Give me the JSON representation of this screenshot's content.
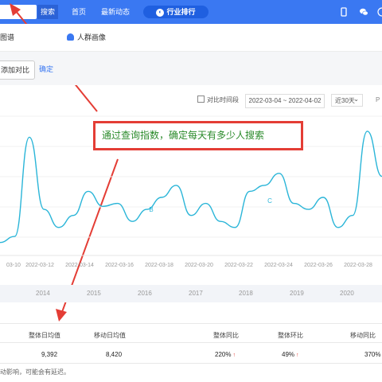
{
  "topbar": {
    "search_label": "搜索",
    "nav": [
      "首页",
      "最新动态"
    ],
    "rank_label": "行业排行",
    "accent": "#3a78f2"
  },
  "tabs": {
    "graph_suffix": "图谱",
    "crowd": "人群画像"
  },
  "compare": {
    "add_label": "添加对比",
    "confirm_label": "确定"
  },
  "filters": {
    "compare_period": "对比时间段",
    "date_range": "2022-03-04 ~ 2022-04-02",
    "days": "近30天",
    "days_arrow": "⌄"
  },
  "annotation": {
    "text": "通过查询指数，确定每天有多少人搜索",
    "border_color": "#e43d35",
    "text_color": "#2a8a2a"
  },
  "chart_data": {
    "type": "line",
    "x_tick_labels": [
      "03-10",
      "2022-03-12",
      "2022-03-14",
      "2022-03-16",
      "2022-03-18",
      "2022-03-20",
      "2022-03-22",
      "2022-03-24",
      "2022-03-26",
      "2022-03-28"
    ],
    "series": [
      {
        "values": [
          3,
          5,
          38,
          14,
          8,
          12,
          20,
          15,
          16,
          10,
          14,
          18,
          22,
          12,
          16,
          10,
          8,
          20,
          22,
          26,
          16,
          14,
          18,
          8,
          12,
          40,
          25
        ]
      }
    ],
    "markers": [
      "B",
      "C"
    ],
    "line_color": "#2ab5d8"
  },
  "timeline": {
    "years": [
      "2014",
      "2015",
      "2016",
      "2017",
      "2018",
      "2019",
      "2020"
    ]
  },
  "table": {
    "headers": [
      "整体日均值",
      "移动日均值",
      "整体同比",
      "整体环比",
      "移动同比"
    ],
    "row": [
      "9,392",
      "8,420",
      "220%",
      "49%",
      "370%"
    ],
    "up_arrow": "↑"
  },
  "footnote": "动影响，可能会有延迟。"
}
